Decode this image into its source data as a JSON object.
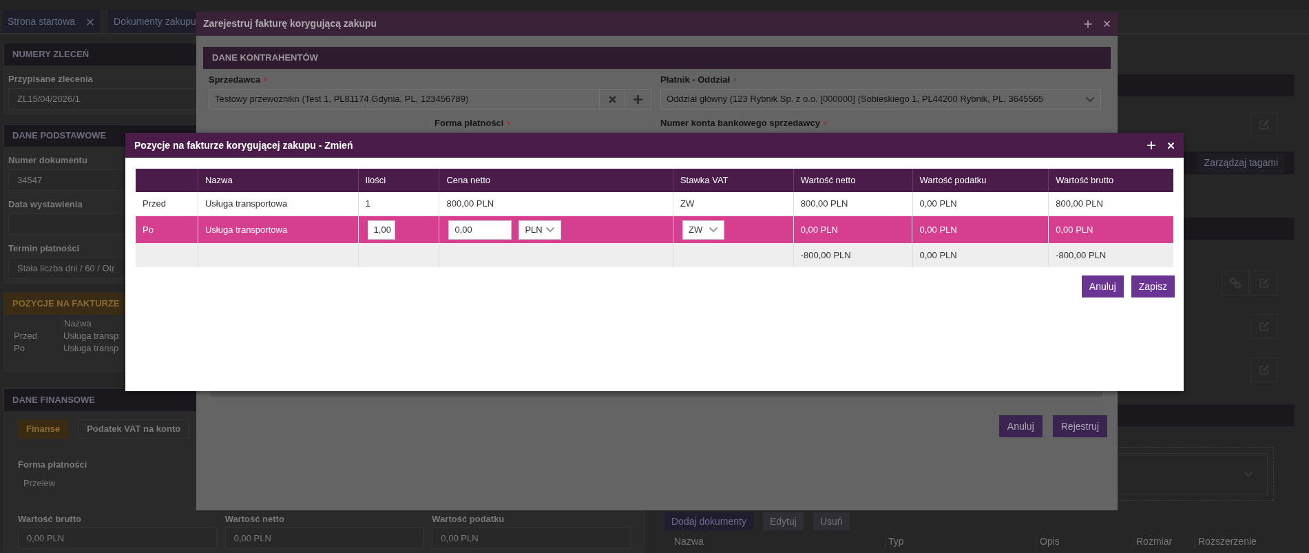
{
  "tabs": [
    {
      "label": "Strona startowa",
      "closable": true
    },
    {
      "label": "Dokumenty zakupu",
      "closable": false
    }
  ],
  "left_sections": [
    {
      "kind": "fields",
      "title": "NUMERY ZLECEŃ",
      "fields": [
        {
          "label": "Przypisane zlecenia",
          "value": "ZL15/04/2026/1"
        }
      ]
    },
    {
      "kind": "fields",
      "title": "DANE PODSTAWOWE",
      "fields": [
        {
          "label": "Numer dokumentu",
          "value": "34547"
        },
        {
          "label": "Data wystawienia"
        },
        {
          "label": "Termin płatności",
          "value": "Stała liczba dni / 60 / Otr"
        }
      ]
    },
    {
      "kind": "positions",
      "title": "POZYCJE NA FAKTURZE",
      "column": "Nazwa",
      "rows": [
        {
          "label": "Przed",
          "name": "Usługa transp"
        },
        {
          "label": "Po",
          "name": "Usługa transp"
        }
      ]
    },
    {
      "kind": "finance",
      "title": "DANE FINANSOWE",
      "tabs": [
        {
          "label": "Finanse",
          "selected": true
        },
        {
          "label": "Podatek VAT na konto",
          "selected": false
        }
      ],
      "payment": {
        "label": "Forma płatności",
        "value": "Przelew"
      },
      "amounts": [
        {
          "label": "Wartość brutto",
          "value": "0,00 PLN"
        },
        {
          "label": "Wartość netto",
          "value": "0,00 PLN"
        },
        {
          "label": "Wartość podatku",
          "value": "0,00 PLN"
        }
      ]
    }
  ],
  "right_panel": {
    "tag_button": "Zarządzaj tagami",
    "document_buttons": [
      "Dodaj dokumenty",
      "Edytuj",
      "Usuń"
    ],
    "document_columns": [
      "Nazwa",
      "Typ",
      "Opis",
      "Rozmiar",
      "Rozszerzenie"
    ]
  },
  "register_dialog": {
    "title": "Zarejestruj fakturę korygującą zakupu",
    "section_title": "DANE KONTRAHENTÓW",
    "seller": {
      "label": "Sprzedawca",
      "required": true,
      "value": "Testowy przewoznikn (Test 1, PL81174 Gdynia, PL, 123456789)"
    },
    "payer": {
      "label": "Płatnik - Oddział",
      "required": true,
      "value": "Oddział główny (123 Rybnik Sp. z o.o. [000000] (Sobieskiego 1, PL44200 Rybnik, PL, 3645565"
    },
    "payment_form": {
      "label": "Forma płatności",
      "required": true
    },
    "bank_account": {
      "label": "Numer konta bankowego sprzedawcy",
      "required": true
    },
    "buttons": [
      "Anuluj",
      "Rejestruj"
    ]
  },
  "positions_dialog": {
    "title": "Pozycje na fakturze korygującej zakupu - Zmień",
    "columns": [
      "Nazwa",
      "Ilości",
      "Cena netto",
      "Stawka VAT",
      "Wartość netto",
      "Wartość podatku",
      "Wartość brutto"
    ],
    "rows": [
      {
        "kind": "before",
        "label": "Przed",
        "name": "Usługa transportowa",
        "quantity": "1",
        "net_price": "800,00 PLN",
        "vat_rate": "ZW",
        "net_value": "800,00 PLN",
        "tax_value": "0,00 PLN",
        "gross_value": "800,00 PLN"
      },
      {
        "kind": "edit",
        "label": "Po",
        "name": "Usługa transportowa",
        "quantity": "1,00",
        "net_price": "0,00",
        "currency": "PLN",
        "vat_rate": "ZW",
        "vat_required": true,
        "net_value": "0,00 PLN",
        "tax_value": "0,00 PLN",
        "gross_value": "0,00 PLN"
      },
      {
        "kind": "total",
        "net_value": "-800,00 PLN",
        "tax_value": "0,00 PLN",
        "gross_value": "-800,00 PLN"
      }
    ],
    "buttons": [
      "Anuluj",
      "Zapisz"
    ]
  }
}
